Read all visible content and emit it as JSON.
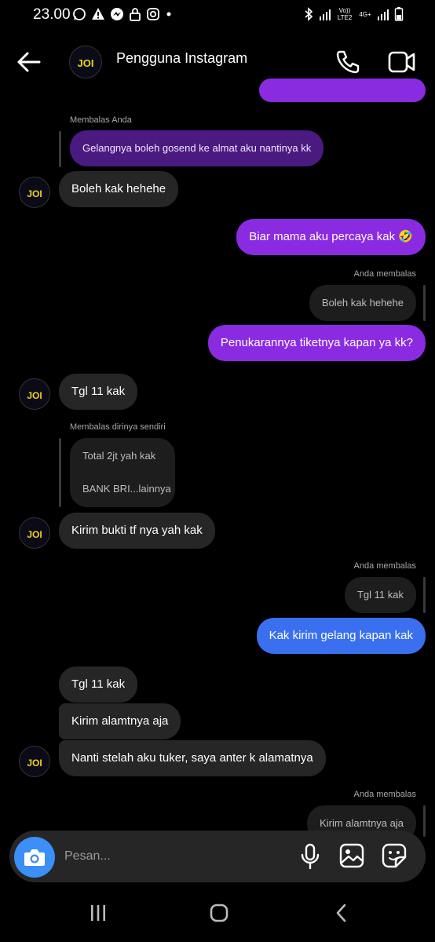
{
  "status_bar": {
    "time": "23.00",
    "net1": "Vo)) LTE2",
    "net2": "4G+"
  },
  "header": {
    "title": "Pengguna Instagram"
  },
  "messages": {
    "reply1_label": "Membalas Anda",
    "reply1_quote": "Gelangnya boleh gosend ke almat aku nantinya kk",
    "m1": "Boleh kak hehehe",
    "m2": "Biar mama aku percaya kak 🤣",
    "reply2_label": "Anda membalas",
    "reply2_quote": "Boleh kak hehehe",
    "m3": "Penukarannya tiketnya kapan ya kk?",
    "m4": "Tgl 11 kak",
    "reply3_label": "Membalas dirinya sendiri",
    "reply3_quote_line1": "Total 2jt yah kak",
    "reply3_quote_line2": "BANK BRI...lainnya",
    "m5": "Kirim bukti tf nya yah kak",
    "reply4_label": "Anda membalas",
    "reply4_quote": "Tgl 11 kak",
    "m6": "Kak kirim gelang kapan kak",
    "m7": "Tgl 11 kak",
    "m8": "Kirim alamtnya aja",
    "m9": "Nanti stelah aku tuker, saya anter k alamatnya",
    "reply5_label": "Anda membalas",
    "reply5_quote": "Kirim alamtnya aja"
  },
  "composer": {
    "placeholder": "Pesan..."
  },
  "avatar_text": "JOI",
  "colors": {
    "outgoing": "#8a2be2",
    "outgoing_blue": "#3a6ff0",
    "incoming": "#262626",
    "camera": "#3b8ff6"
  },
  "icons": [
    "back-arrow-icon",
    "phone-icon",
    "video-icon",
    "camera-icon",
    "microphone-icon",
    "gallery-icon",
    "sticker-icon",
    "recent-apps-icon",
    "home-icon",
    "back-nav-icon"
  ]
}
